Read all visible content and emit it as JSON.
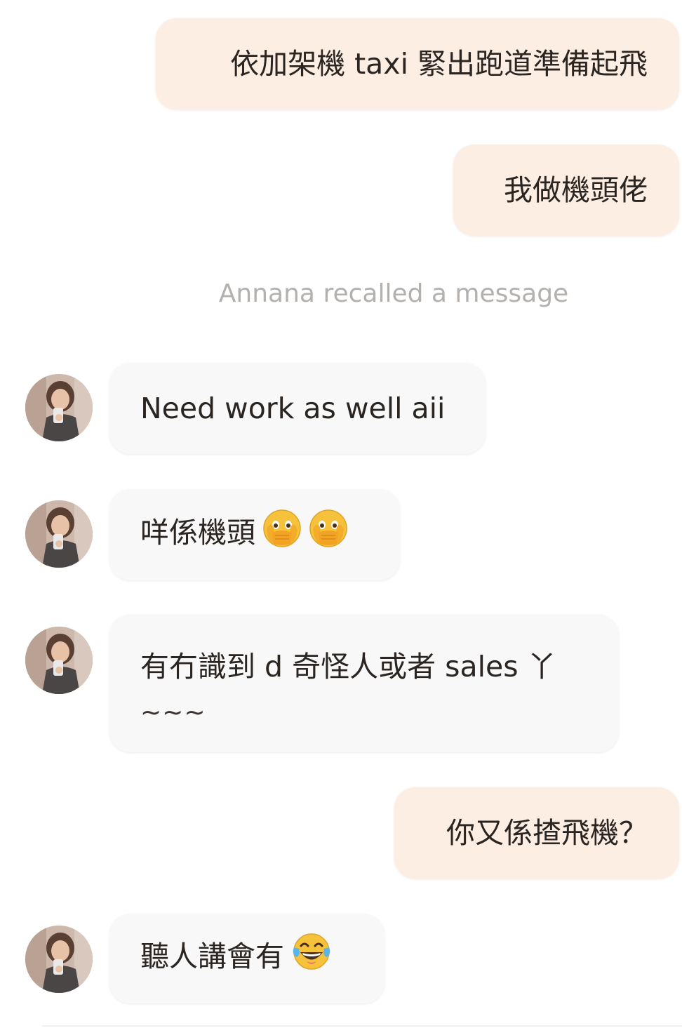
{
  "messages": [
    {
      "sender": "me",
      "text": "依加架機 taxi 緊出跑道準備起飛"
    },
    {
      "sender": "me",
      "text": "我做機頭佬"
    },
    {
      "system": "Annana recalled a message"
    },
    {
      "sender": "Annana",
      "text": "Need work as well aii"
    },
    {
      "sender": "Annana",
      "text": "咩係機頭",
      "emoji": [
        "face-with-open-eyes-and-hand-over-mouth-icon",
        "face-with-open-eyes-and-hand-over-mouth-icon"
      ]
    },
    {
      "sender": "Annana",
      "line1": "有冇識到 d 奇怪人或者 sales 丫",
      "line2": "~~~"
    },
    {
      "sender": "me",
      "text": "你又係揸飛機？"
    },
    {
      "sender": "Annana",
      "text": "聽人講會有",
      "emoji": [
        "face-with-tears-of-joy-icon"
      ]
    }
  ],
  "colors": {
    "outgoing_bubble": "#fdeee3",
    "incoming_bubble": "#f8f8f8",
    "system_text": "#b3b0ad",
    "message_text": "#2b2522"
  }
}
